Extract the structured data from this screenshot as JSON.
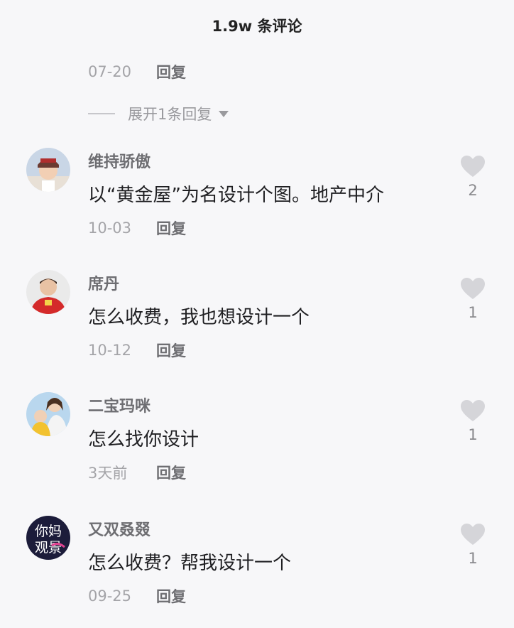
{
  "header": {
    "title": "1.9w 条评论"
  },
  "previous_reply": {
    "date": "07-20",
    "reply_label": "回复"
  },
  "expand": {
    "label": "展开1条回复"
  },
  "comments": [
    {
      "username": "维持骄傲",
      "text": "以“黄金屋”为名设计个图。地产中介",
      "date": "10-03",
      "reply_label": "回复",
      "likes": "2",
      "avatar": "avatar-photo-child"
    },
    {
      "username": "席丹",
      "text": "怎么收费，我也想设计一个",
      "date": "10-12",
      "reply_label": "回复",
      "likes": "1",
      "avatar": "avatar-photo-man-red"
    },
    {
      "username": "二宝玛咪",
      "text": "怎么找你设计",
      "date": "3天前",
      "reply_label": "回复",
      "likes": "1",
      "avatar": "avatar-photo-mother-kids"
    },
    {
      "username": "又双叒叕",
      "text": "怎么收费？帮我设计一个",
      "date": "09-25",
      "reply_label": "回复",
      "likes": "1",
      "avatar": "avatar-logo-text",
      "avatar_text": [
        "你妈",
        "观景"
      ]
    }
  ],
  "colors": {
    "background": "#f7f7f9",
    "text_primary": "#1f1f22",
    "text_secondary": "#6e6e72",
    "text_muted": "#a4a4a8",
    "heart": "#d5d5d9"
  }
}
